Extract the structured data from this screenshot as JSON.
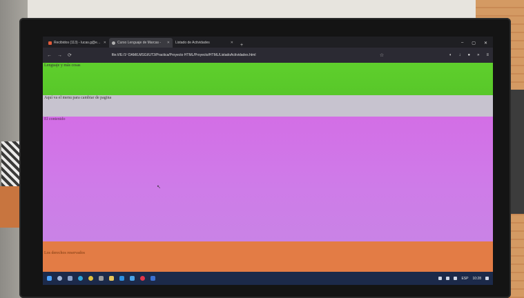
{
  "browser": {
    "tabs": [
      {
        "label": "Recibidos (113) - lucas.g@e…",
        "icon_color": "#e25b3a",
        "active": false
      },
      {
        "label": "Curso Lenguaje de Marcas -",
        "icon_color": "#b0b0b0",
        "active": true
      },
      {
        "label": "Listado de Actividades",
        "icon_color": "#9a9a9a",
        "active": false
      }
    ],
    "new_tab": "+",
    "url": "file:///E:/1º DAM/LMSGI/UT3/Practica/Proyecto HTML/Proyecto/HTML/ListadoActividades.html",
    "window_controls": [
      "–",
      "▢",
      "✕"
    ]
  },
  "page": {
    "header_text": "Lenguaje y más cosas",
    "nav_text": "Aquí va el menu para cambiar de pagina",
    "main_text": "El contenido",
    "footer_text": "Los derechos reservados"
  },
  "colors": {
    "header": "#5fcf2c",
    "nav": "#c7c3cf",
    "main": "#cf7ae8",
    "footer": "#e37c45"
  },
  "taskbar": {
    "tray_lang": "ESP",
    "tray_time": "10:28"
  }
}
